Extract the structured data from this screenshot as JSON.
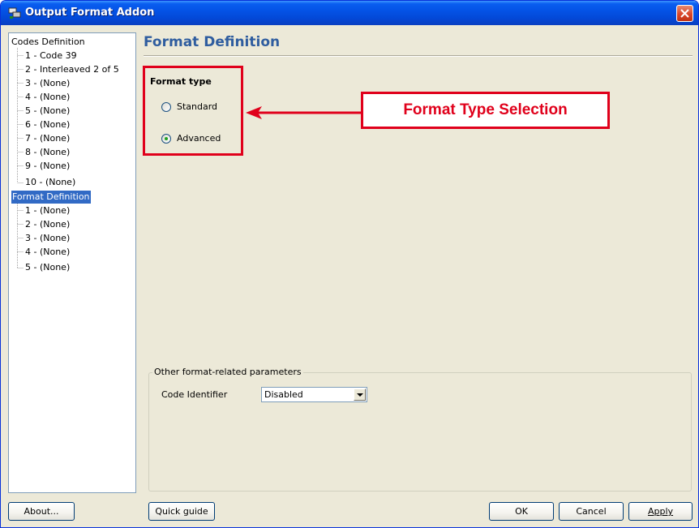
{
  "window": {
    "title": "Output Format Addon"
  },
  "tree": {
    "groups": [
      {
        "label": "Codes Definition",
        "items": [
          "1 - Code 39",
          "2 - Interleaved 2 of 5",
          "3 - (None)",
          "4 - (None)",
          "5 - (None)",
          "6 - (None)",
          "7 - (None)",
          "8 - (None)",
          "9 - (None)",
          "10 - (None)"
        ]
      },
      {
        "label": "Format Definition",
        "selected": true,
        "items": [
          "1 - (None)",
          "2 - (None)",
          "3 - (None)",
          "4 - (None)",
          "5 - (None)"
        ]
      }
    ]
  },
  "panel": {
    "title": "Format Definition",
    "format_type": {
      "label": "Format type",
      "options": [
        {
          "label": "Standard",
          "checked": false
        },
        {
          "label": "Advanced",
          "checked": true
        }
      ]
    },
    "annotation": "Format Type Selection",
    "other_params": {
      "legend": "Other format-related parameters",
      "code_identifier_label": "Code Identifier",
      "code_identifier_value": "Disabled"
    }
  },
  "buttons": {
    "about": "About...",
    "quick_guide": "Quick guide",
    "ok": "OK",
    "cancel": "Cancel",
    "apply": "Apply"
  },
  "colors": {
    "annotation_red": "#e0001b",
    "header_blue": "#2f5d9f",
    "selection_blue": "#316ac5"
  }
}
